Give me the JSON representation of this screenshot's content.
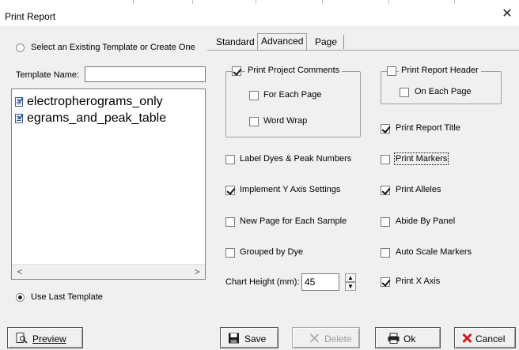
{
  "window": {
    "title": "Print Report"
  },
  "left_panel": {
    "select_template_label": "Select an Existing Template or Create One",
    "template_name_label": "Template Name:",
    "template_name_value": "",
    "templates": [
      {
        "name": "electropherograms_only"
      },
      {
        "name": "egrams_and_peak_table"
      }
    ],
    "use_last_template_label": "Use Last Template",
    "select_template_selected": false,
    "use_last_template_selected": true
  },
  "tabs": [
    {
      "label": "Standard",
      "active": false
    },
    {
      "label": "Advanced",
      "active": true
    },
    {
      "label": "Page",
      "active": false
    }
  ],
  "options": {
    "print_project_comments": {
      "label": "Print Project Comments",
      "checked": true
    },
    "for_each_page": {
      "label": "For Each Page",
      "checked": false
    },
    "word_wrap": {
      "label": "Word Wrap",
      "checked": false
    },
    "print_report_header": {
      "label": "Print Report Header",
      "checked": false
    },
    "on_each_page": {
      "label": "On Each Page",
      "checked": false
    },
    "print_report_title": {
      "label": "Print Report Title",
      "checked": true
    },
    "label_dyes_peak_numbers": {
      "label": "Label Dyes & Peak Numbers",
      "checked": false
    },
    "print_markers": {
      "label": "Print Markers",
      "checked": false
    },
    "implement_y_axis": {
      "label": "Implement  Y Axis Settings",
      "checked": true
    },
    "print_alleles": {
      "label": "Print Alleles",
      "checked": true
    },
    "new_page_each_sample": {
      "label": "New Page for Each Sample",
      "checked": false
    },
    "abide_by_panel": {
      "label": "Abide By Panel",
      "checked": false
    },
    "grouped_by_dye": {
      "label": "Grouped by Dye",
      "checked": false
    },
    "auto_scale_markers": {
      "label": "Auto Scale Markers",
      "checked": false
    },
    "print_x_axis": {
      "label": "Print X Axis",
      "checked": true
    }
  },
  "chart_height": {
    "label": "Chart Height (mm):",
    "value": "45"
  },
  "buttons": {
    "preview": "Preview",
    "save": "Save",
    "delete": "Delete",
    "ok": "Ok",
    "cancel": "Cancel"
  },
  "colors": {
    "accent_save": "#0a246a",
    "cancel_x": "#d11a1a"
  }
}
